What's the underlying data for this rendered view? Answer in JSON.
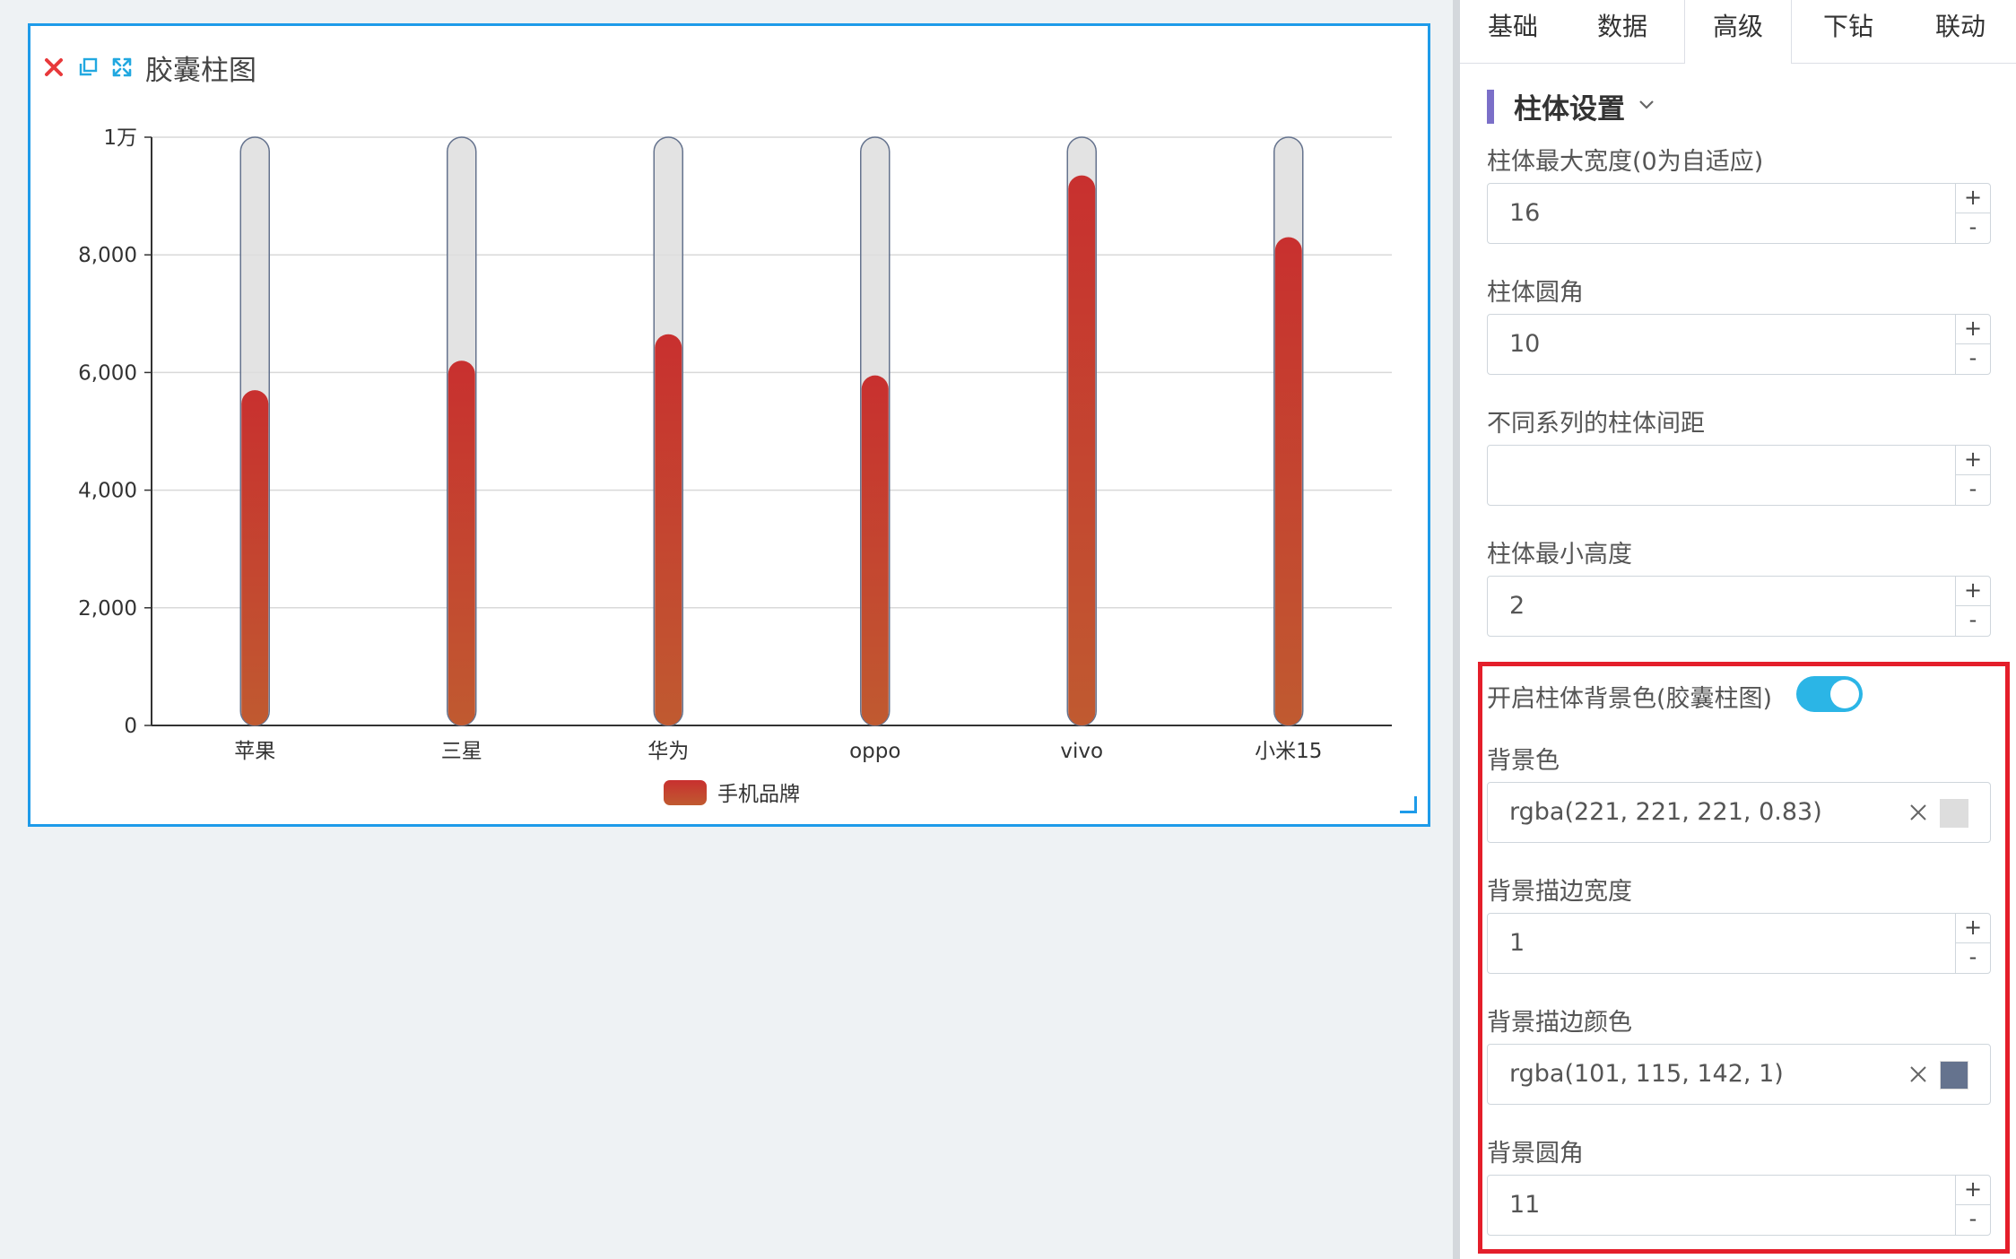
{
  "card": {
    "title": "胶囊柱图",
    "icons": [
      "close-icon",
      "copy-icon",
      "expand-icon"
    ]
  },
  "chart_data": {
    "type": "bar",
    "variant": "capsule",
    "categories": [
      "苹果",
      "三星",
      "华为",
      "oppo",
      "vivo",
      "小米15"
    ],
    "series": [
      {
        "name": "手机品牌",
        "values": [
          5700,
          6200,
          6650,
          5950,
          9350,
          8300
        ]
      }
    ],
    "ylim": [
      0,
      10000
    ],
    "yticks": [
      {
        "value": 0,
        "label": "0"
      },
      {
        "value": 2000,
        "label": "2,000"
      },
      {
        "value": 4000,
        "label": "4,000"
      },
      {
        "value": 6000,
        "label": "6,000"
      },
      {
        "value": 8000,
        "label": "8,000"
      },
      {
        "value": 10000,
        "label": "1万"
      }
    ],
    "grid": true,
    "legend_position": "bottom-center",
    "colors": {
      "bar_top": "#c8302f",
      "bar_bottom": "#c05a30",
      "background": "rgba(221, 221, 221, 0.83)",
      "background_border": "rgba(101, 115, 142, 1)"
    }
  },
  "panel": {
    "tabs": [
      "基础",
      "数据",
      "高级",
      "下钻",
      "联动"
    ],
    "active_tab": "高级",
    "section_title": "柱体设置",
    "fields": {
      "max_width": {
        "label": "柱体最大宽度(0为自适应)",
        "value": "16"
      },
      "radius": {
        "label": "柱体圆角",
        "value": "10"
      },
      "series_gap": {
        "label": "不同系列的柱体间距",
        "value": ""
      },
      "min_height": {
        "label": "柱体最小高度",
        "value": "2"
      },
      "bg_enable": {
        "label": "开启柱体背景色(胶囊柱图)",
        "value": true
      },
      "bg_color": {
        "label": "背景色",
        "value": "rgba(221, 221, 221, 0.83)",
        "swatch": "#dddddd"
      },
      "bg_border_width": {
        "label": "背景描边宽度",
        "value": "1"
      },
      "bg_border_color": {
        "label": "背景描边颜色",
        "value": "rgba(101, 115, 142, 1)",
        "swatch": "#65738e"
      },
      "bg_radius": {
        "label": "背景圆角",
        "value": "11"
      }
    },
    "stepper": {
      "plus": "+",
      "minus": "-"
    },
    "highlight_color": "#e41e2a",
    "accent_color": "#2bb5e6"
  }
}
